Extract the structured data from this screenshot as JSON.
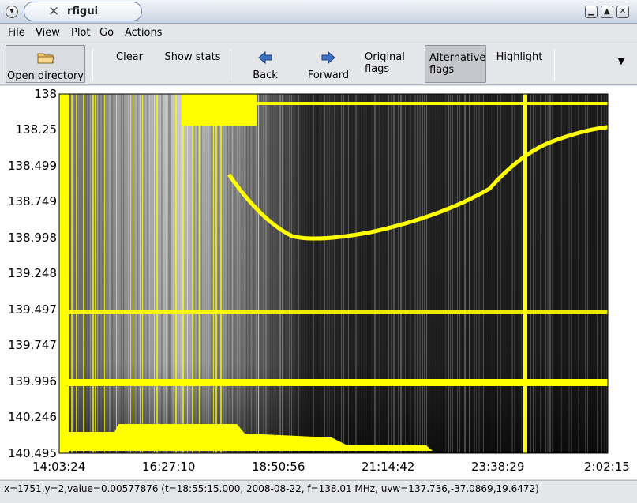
{
  "window": {
    "title": "rfigui",
    "controls": [
      "minimize-icon",
      "maximize-icon",
      "close-icon"
    ]
  },
  "menu": {
    "file": "File",
    "view": "View",
    "plot": "Plot",
    "go": "Go",
    "actions": "Actions"
  },
  "toolbar": {
    "open_directory": "Open directory",
    "clear": "Clear",
    "show_stats": "Show stats",
    "back": "Back",
    "forward": "Forward",
    "original_flags_1": "Original",
    "original_flags_2": "flags",
    "alternative_flags_1": "Alternative",
    "alternative_flags_2": "flags",
    "highlight": "Highlight"
  },
  "plot": {
    "y_ticks": [
      "138",
      "138.25",
      "138.499",
      "138.749",
      "138.998",
      "139.248",
      "139.497",
      "139.747",
      "139.996",
      "140.246",
      "140.495"
    ],
    "x_ticks": [
      "14:03:24",
      "16:27:10",
      "18:50:56",
      "21:14:42",
      "23:38:29",
      "2:02:15"
    ],
    "colors": {
      "flag": "#ffff00",
      "background": "#1a1a1a"
    }
  },
  "status": {
    "text": "x=1751,y=2,value=0.00577876 (t=18:55:15.000, 2008-08-22, f=138.01 MHz, uvw=137.736,-37.0869,19.6472)"
  }
}
